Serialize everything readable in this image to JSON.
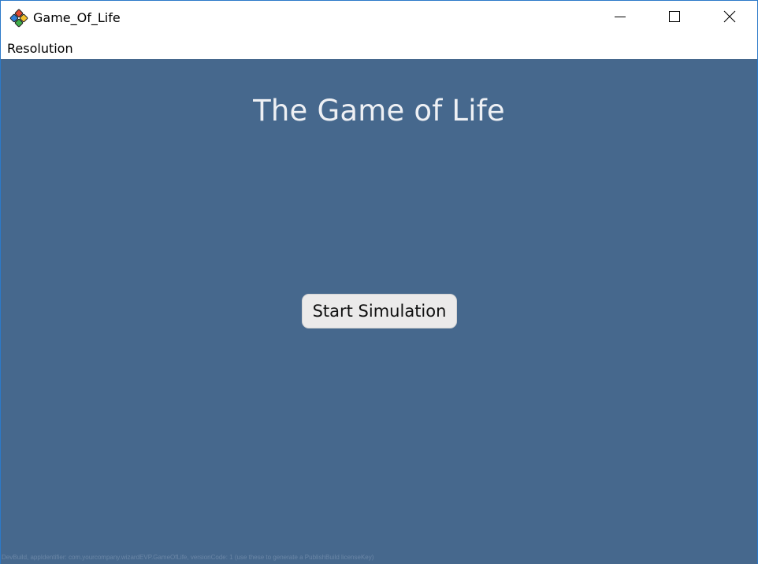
{
  "window": {
    "title": "Game_Of_Life",
    "app_icon": "multicolor-diamond-app-icon",
    "controls": {
      "minimize_icon": "minimize-icon",
      "maximize_icon": "maximize-icon",
      "close_icon": "close-icon"
    }
  },
  "menubar": {
    "items": [
      {
        "label": "Resolution"
      }
    ]
  },
  "main": {
    "heading": "The Game of Life",
    "start_button_label": "Start Simulation",
    "footer_note": "DevBuild, appIdentifier: com.yourcompany.wizardEVP.GameOfLife, versionCode: 1 (use these to generate a PublishBuild licenseKey)"
  },
  "colors": {
    "background": "#46688d",
    "window_border": "#2b79c9",
    "heading_text": "#eef0f4",
    "button_fill": "#ebeaea"
  }
}
